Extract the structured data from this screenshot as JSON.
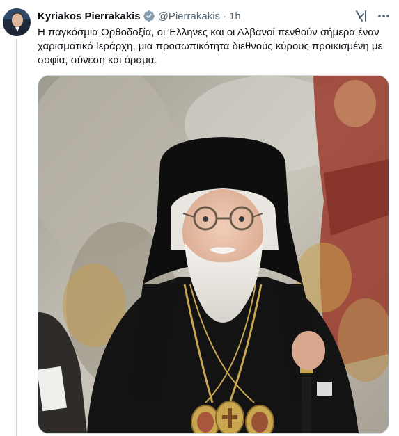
{
  "tweet": {
    "author_name": "Kyriakos Pierrakakis",
    "handle": "@Pierrakakis",
    "separator": "·",
    "time": "1h",
    "text": "Η παγκόσμια Ορθοδοξία, οι Έλληνες και οι Αλβανοί πενθούν σήμερα έναν χαρισματικό Ιεράρχη, μια προσωπικότητα διεθνούς κύρους προικισμένη με σοφία, σύνεση και όραμα."
  },
  "icons": {
    "verified": "verified-badge-icon",
    "grok": "grok-icon",
    "more": "more-options-icon"
  },
  "colors": {
    "verified_badge": "#829aab",
    "secondary_text": "#536471",
    "primary_text": "#0f1419",
    "thread_line": "#cfd9de"
  }
}
